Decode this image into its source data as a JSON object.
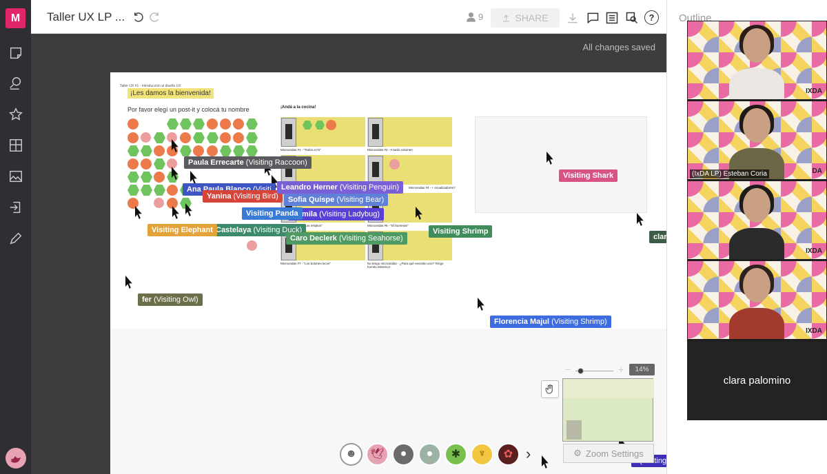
{
  "app": {
    "logo_letter": "M",
    "brand_color": "#e2266b"
  },
  "header": {
    "title": "Taller UX LP ...",
    "member_count": "9",
    "share_label": "SHARE",
    "help_label": "?"
  },
  "canvas": {
    "status": "All changes saved",
    "board": {
      "header_tiny": "Taller UX #1 - Introducción al diseño UX",
      "welcome": "¡Les damos la bienvenida!",
      "instruction": "Por favor elegí un post-it y colocá tu nombre",
      "kitchen_title": "¡Andá a la cocina!",
      "cells": [
        {
          "caption": "Microondas #1 - \"Todos a mi\""
        },
        {
          "caption": "Microondas #2 - A tardo volumen"
        },
        {
          "caption": "Microondas #3 -"
        },
        {
          "caption": "Microondas #4 - + ecualizadores?"
        },
        {
          "caption": "Microondas #5 - \"Los relojitos\""
        },
        {
          "caption": "Microondas #6 - \"El bumeran\""
        },
        {
          "caption": "Microondas #7 - \"Los botones locos\""
        },
        {
          "caption": "No tengo microondas - ¿Para qué necesito uno? Tengo hornito eléctrico!"
        }
      ]
    },
    "cursors": [
      {
        "name": "Paula Errecarte",
        "visiting": "(Visiting Raccoon)",
        "color": "#5a5a5f"
      },
      {
        "name": "Ana Paula Blanco",
        "visiting": "(Visiti",
        "color": "#3e56c4"
      },
      {
        "name": "Yanina",
        "visiting": "(Visiting Bird)",
        "color": "#d7453a"
      },
      {
        "name": "Leandro Herner",
        "visiting": "(Visiting Penguin)",
        "color": "#7b5fd6"
      },
      {
        "name": "Sofia Quispe",
        "visiting": "(Visiting Bear)",
        "color": "#5f80d6"
      },
      {
        "name": "Camila",
        "visiting": "(Visiting Ladybug)",
        "color": "#5840d6"
      },
      {
        "name": "Visiting Panda",
        "visiting": "",
        "color": "#3a7bd6"
      },
      {
        "name": "Visiting Elephant",
        "visiting": "",
        "color": "#e2a43a"
      },
      {
        "name": "Castelaya",
        "visiting": "(Visiting Duck)",
        "color": "#3c8a6b"
      },
      {
        "name": "Caro Declerk",
        "visiting": "(Visiting Seahorse)",
        "color": "#4f9a62"
      },
      {
        "name": "Visiting Shrimp",
        "visiting": "",
        "color": "#3f8c5d"
      },
      {
        "name": "Visiting Shark",
        "visiting": "",
        "color": "#d85384"
      },
      {
        "name": "fer",
        "visiting": "(Visiting Owl)",
        "color": "#6b6e48"
      },
      {
        "name": "Florencia Majul",
        "visiting": "(Visiting Shrimp)",
        "color": "#3d6be0"
      },
      {
        "name": "clar",
        "visiting": "",
        "color": "#3e5b48"
      },
      {
        "name": "l",
        "visiting": "(Visiting",
        "color": "#3d2fb8"
      }
    ],
    "zoom": {
      "level": "14%",
      "minus": "−",
      "plus": "+"
    },
    "zoom_settings_label": "Zoom Settings"
  },
  "outline": {
    "title": "Outline"
  },
  "video": {
    "tiles": [
      {
        "name": "",
        "logo": "IXDA"
      },
      {
        "name": "(IxDA LP) Esteban Coria",
        "logo": "DA"
      },
      {
        "name": "",
        "logo": "IXDA"
      },
      {
        "name": "",
        "logo": "IXDA"
      }
    ],
    "audio_only_name": "clara palomino"
  }
}
